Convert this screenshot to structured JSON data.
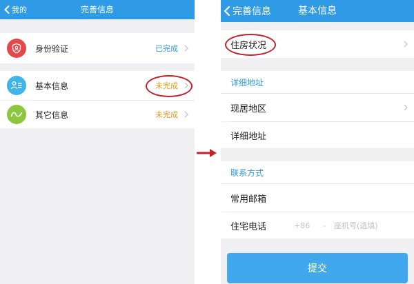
{
  "left": {
    "back_label": "我的",
    "title": "完善信息",
    "items": [
      {
        "label": "身份验证",
        "status": "已完成",
        "icon": "shield-icon",
        "icon_color": "#e4484a"
      },
      {
        "label": "基本信息",
        "status": "未完成",
        "icon": "person-card-icon",
        "icon_color": "#3fb5e9"
      },
      {
        "label": "其它信息",
        "status": "未完成",
        "icon": "wave-icon",
        "icon_color": "#8dc63f"
      }
    ]
  },
  "right": {
    "back_label": "完善信息",
    "title": "基本信息",
    "housing_label": "住房状况",
    "address_section": "详细地址",
    "current_region_label": "现居地区",
    "detail_address_label": "详细地址",
    "contact_section": "联系方式",
    "email_label": "常用邮箱",
    "phone_label": "住宅电话",
    "phone_prefix": "+86",
    "phone_separator": "-",
    "phone_placeholder": "座机号(选填)",
    "submit_label": "提交"
  },
  "colors": {
    "nav_blue": "#2f9be6",
    "done_blue": "#2f9be6",
    "todo_orange": "#e09a1f",
    "highlight_red": "#c6202a",
    "submit_blue": "#42a8ee"
  }
}
